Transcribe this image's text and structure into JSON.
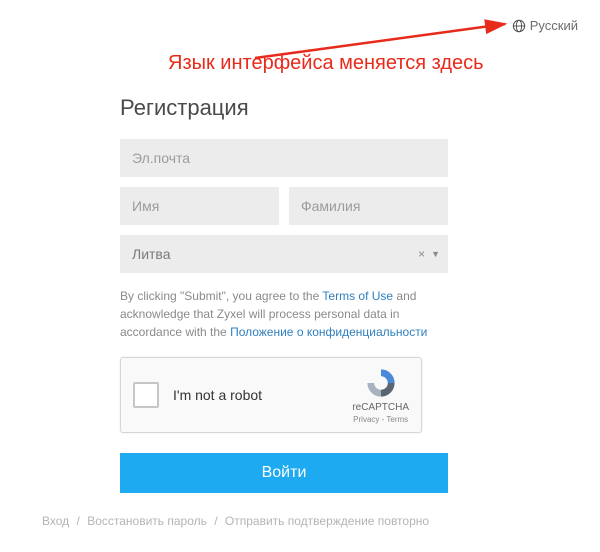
{
  "lang": {
    "current": "Русский"
  },
  "annotation": {
    "text": "Язык интерфейса меняется здесь"
  },
  "title": "Регистрация",
  "form": {
    "email_placeholder": "Эл.почта",
    "first_placeholder": "Имя",
    "last_placeholder": "Фамилия",
    "country_selected": "Литва"
  },
  "consent": {
    "prefix": "By clicking \"Submit\", you agree to the ",
    "terms": "Terms of Use",
    "mid": " and acknowledge that Zyxel will process personal data in accordance with the ",
    "privacy": "Положение о конфиденциальности"
  },
  "captcha": {
    "label": "I'm not a robot",
    "brand": "reCAPTCHA",
    "links": "Privacy - Terms"
  },
  "submit": "Войти",
  "footer": {
    "login": "Вход",
    "recover": "Восстановить пароль",
    "resend": "Отправить подтверждение повторно"
  }
}
